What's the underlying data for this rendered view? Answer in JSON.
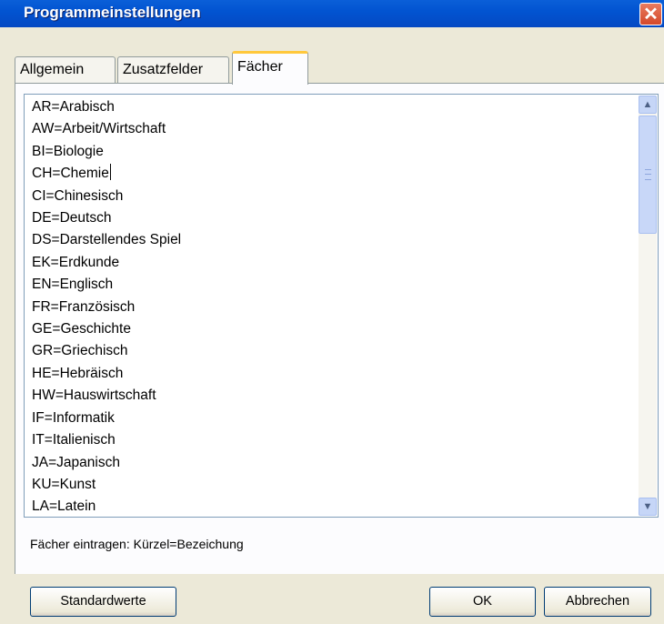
{
  "window": {
    "title": "Programmeinstellungen",
    "close_symbol": "✕"
  },
  "tabs": [
    {
      "label": "Allgemein"
    },
    {
      "label": "Zusatzfelder"
    },
    {
      "label": "Fächer"
    }
  ],
  "subjects": [
    "AR=Arabisch",
    "AW=Arbeit/Wirtschaft",
    "BI=Biologie",
    "CH=Chemie",
    "CI=Chinesisch",
    "DE=Deutsch",
    "DS=Darstellendes Spiel",
    "EK=Erdkunde",
    "EN=Englisch",
    "FR=Französisch",
    "GE=Geschichte",
    "GR=Griechisch",
    "HE=Hebräisch",
    "HW=Hauswirtschaft",
    "IF=Informatik",
    "IT=Italienisch",
    "JA=Japanisch",
    "KU=Kunst",
    "LA=Latein"
  ],
  "hint": "Fächer eintragen:   Kürzel=Bezeichung",
  "buttons": {
    "defaults": "Standardwerte",
    "ok": "OK",
    "cancel": "Abbrechen"
  },
  "scrollbar": {
    "up_symbol": "▲",
    "down_symbol": "▼",
    "position_fraction": 0
  },
  "colors": {
    "titlebar": "#0254d1",
    "active_tab_accent": "#ffc83c",
    "close_button": "#d4482a"
  }
}
